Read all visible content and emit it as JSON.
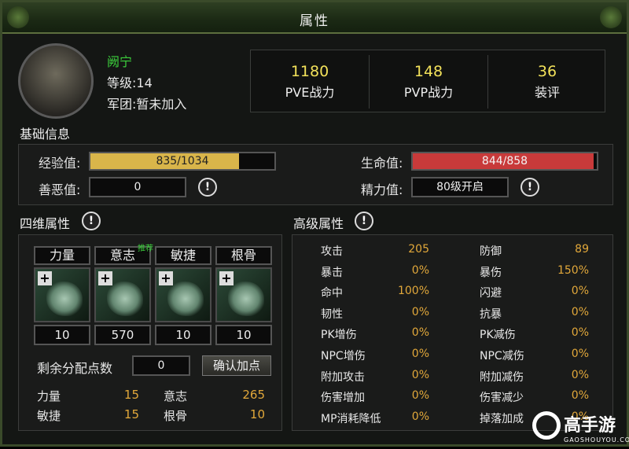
{
  "window": {
    "title": "属性"
  },
  "profile": {
    "name": "阙宁",
    "level": "等级:14",
    "guild": "军团:暂未加入"
  },
  "power": [
    {
      "value": "1180",
      "label": "PVE战力"
    },
    {
      "value": "148",
      "label": "PVP战力"
    },
    {
      "value": "36",
      "label": "装评"
    }
  ],
  "basic": {
    "title": "基础信息",
    "exp_label": "经验值:",
    "exp_text": "835/1034",
    "exp_fraction": 0.8075,
    "karma_label": "善恶值:",
    "karma_value": "0",
    "hp_label": "生命值:",
    "hp_text": "844/858",
    "hp_fraction": 0.9837,
    "energy_label": "精力值:",
    "energy_value": "80级开启"
  },
  "four_stats": {
    "title": "四维属性",
    "recommend_tag": "推荐",
    "stats": [
      {
        "name": "力量",
        "value": "10"
      },
      {
        "name": "意志",
        "value": "570"
      },
      {
        "name": "敏捷",
        "value": "10"
      },
      {
        "name": "根骨",
        "value": "10"
      }
    ],
    "remaining_label": "剩余分配点数",
    "remaining_value": "0",
    "confirm_button": "确认加点",
    "summary": [
      {
        "label": "力量",
        "value": "15"
      },
      {
        "label": "意志",
        "value": "265"
      },
      {
        "label": "敏捷",
        "value": "15"
      },
      {
        "label": "根骨",
        "value": "10"
      }
    ]
  },
  "advanced": {
    "title": "高级属性",
    "left": [
      {
        "label": "攻击",
        "value": "205"
      },
      {
        "label": "暴击",
        "value": "0%"
      },
      {
        "label": "命中",
        "value": "100%"
      },
      {
        "label": "韧性",
        "value": "0%"
      },
      {
        "label": "PK增伤",
        "value": "0%"
      },
      {
        "label": "NPC增伤",
        "value": "0%"
      },
      {
        "label": "附加攻击",
        "value": "0%"
      },
      {
        "label": "伤害增加",
        "value": "0%"
      },
      {
        "label": "MP消耗降低",
        "value": "0%"
      }
    ],
    "right": [
      {
        "label": "防御",
        "value": "89"
      },
      {
        "label": "暴伤",
        "value": "150%"
      },
      {
        "label": "闪避",
        "value": "0%"
      },
      {
        "label": "抗暴",
        "value": "0%"
      },
      {
        "label": "PK减伤",
        "value": "0%"
      },
      {
        "label": "NPC减伤",
        "value": "0%"
      },
      {
        "label": "附加减伤",
        "value": "0%"
      },
      {
        "label": "伤害减少",
        "value": "0%"
      },
      {
        "label": "掉落加成",
        "value": "0%"
      }
    ]
  },
  "watermark": {
    "brand": "高手游",
    "site": "GAOSHOUYOU.COM"
  },
  "colors": {
    "exp_bar": "#d9b54a",
    "hp_bar": "#c83a3a",
    "name": "#3ccf3c",
    "accent_value": "#e2a83a"
  }
}
